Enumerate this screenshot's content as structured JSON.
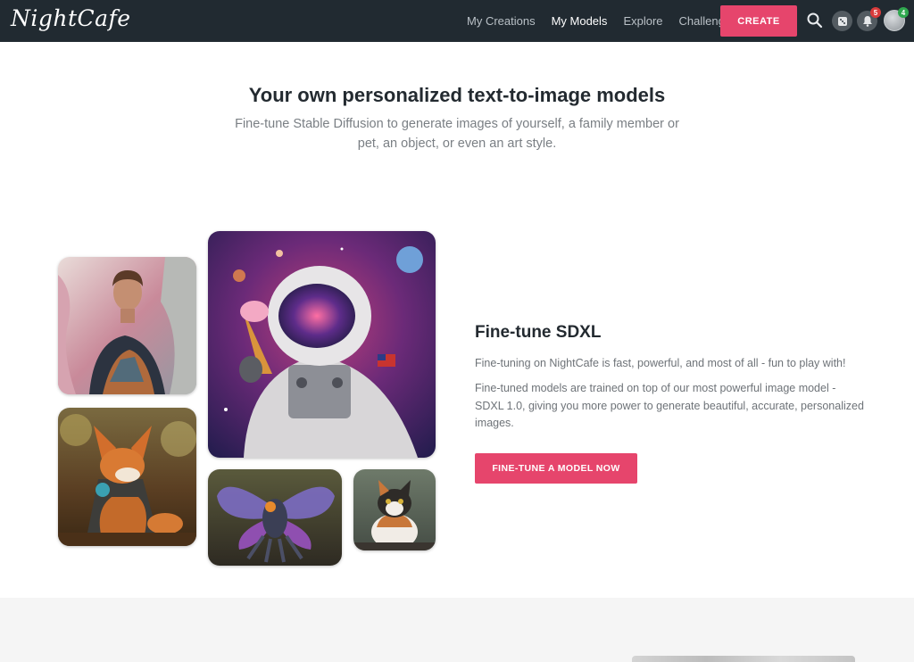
{
  "nav": {
    "logo": "NightCafe",
    "links": [
      "My Creations",
      "My Models",
      "Explore",
      "Challenges"
    ],
    "active_link": "My Models",
    "create_label": "CREATE",
    "notifications_count": "5",
    "profile_count": "4",
    "colors": {
      "bar": "#212a31",
      "accent": "#e6456c",
      "notif_badge": "#d93b3b",
      "profile_badge": "#2fa84f"
    }
  },
  "hero": {
    "title": "Your own personalized text-to-image models",
    "subtitle": "Fine-tune Stable Diffusion to generate images of yourself, a family member or pet, an object, or even an art style."
  },
  "feature": {
    "title": "Fine-tune SDXL",
    "p1": "Fine-tuning on NightCafe is fast, powerful, and most of all - fun to play with!",
    "p2": "Fine-tuned models are trained on top of our most powerful image model - SDXL 1.0, giving you more power to generate beautiful, accurate, personalized images.",
    "button_label": "FINE-TUNE A MODEL NOW"
  },
  "icons": [
    "search-icon",
    "dice-icon",
    "bell-icon",
    "avatar"
  ]
}
